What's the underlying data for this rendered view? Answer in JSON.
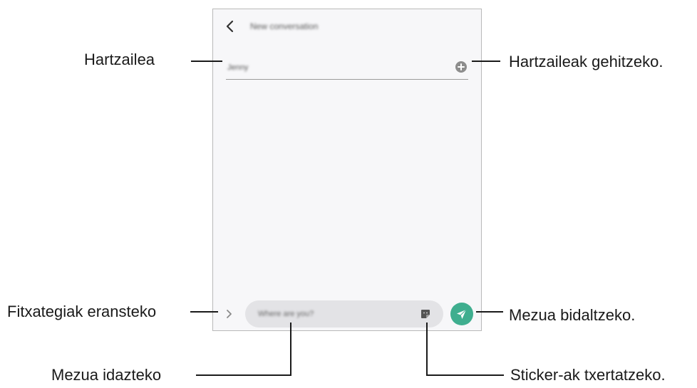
{
  "screen": {
    "title": "New conversation",
    "recipient": "Jenny",
    "message_placeholder": "Where are you?"
  },
  "icons": {
    "back": "chevron-left-icon",
    "add_recipient": "plus-circle-icon",
    "attach": "chevron-right-icon",
    "sticker": "sticker-icon",
    "send": "paper-plane-icon"
  },
  "callouts": {
    "recipient": "Hartzailea",
    "add_recipients": "Hartzaileak gehitzeko.",
    "attach_files": "Fitxategiak eransteko",
    "send_message": "Mezua bidaltzeko.",
    "write_message": "Mezua idazteko",
    "insert_stickers": "Sticker-ak txertatzeko."
  },
  "colors": {
    "send_button": "#3fae8f",
    "screen_background": "#f7f7f9",
    "message_field": "#e3e3e6"
  }
}
